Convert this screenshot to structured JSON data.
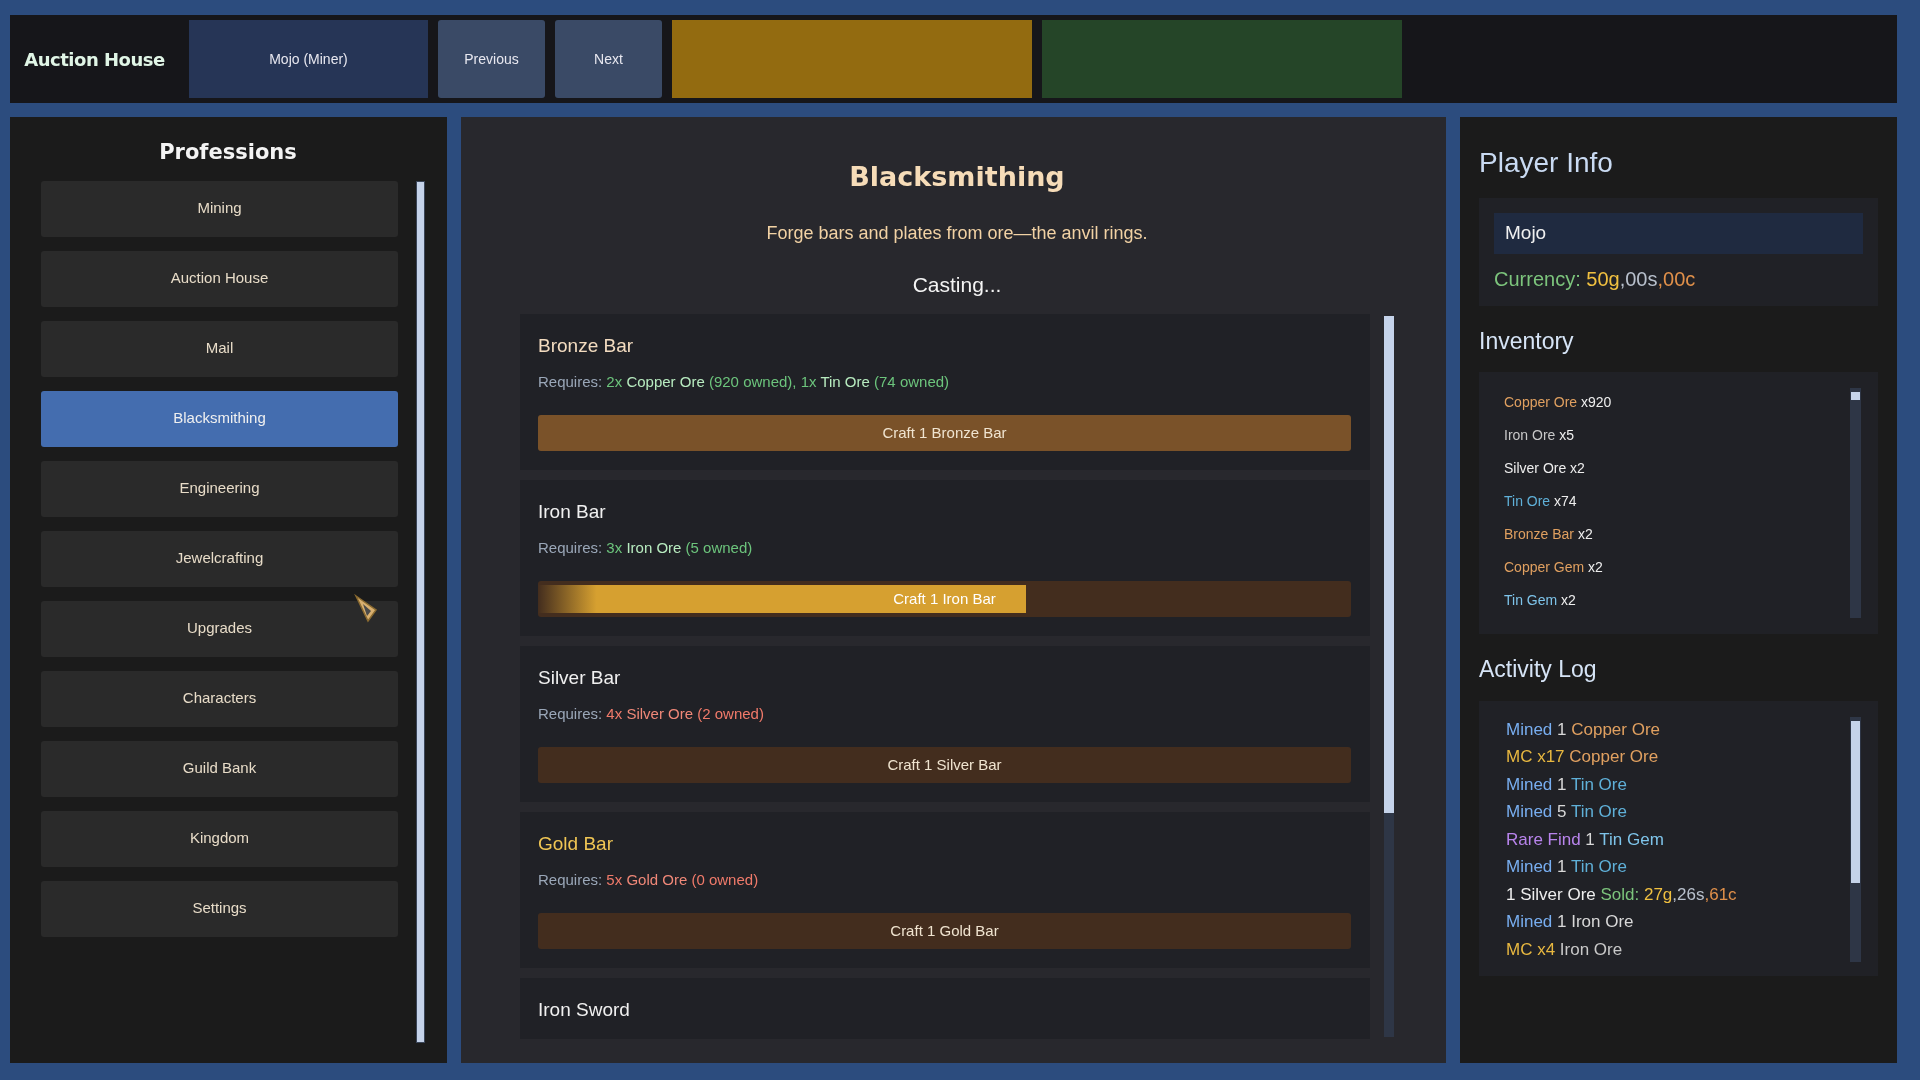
{
  "header": {
    "logo": "Auction House",
    "buttons": [
      {
        "label": "Mojo (Miner)",
        "kind": "character"
      },
      {
        "label": "Previous",
        "kind": "nav"
      },
      {
        "label": "Next",
        "kind": "nav"
      }
    ],
    "blocks": [
      {
        "color": "#936b10"
      },
      {
        "color": "#254528"
      }
    ]
  },
  "sidebar": {
    "title": "Professions",
    "items": [
      {
        "label": "Mining",
        "selected": false
      },
      {
        "label": "Auction House",
        "selected": false
      },
      {
        "label": "Mail",
        "selected": false
      },
      {
        "label": "Blacksmithing",
        "selected": true
      },
      {
        "label": "Engineering",
        "selected": false
      },
      {
        "label": "Jewelcrafting",
        "selected": false
      },
      {
        "label": "Upgrades",
        "selected": false
      },
      {
        "label": "Characters",
        "selected": false
      },
      {
        "label": "Guild Bank",
        "selected": false
      },
      {
        "label": "Kingdom",
        "selected": false
      },
      {
        "label": "Settings",
        "selected": false
      }
    ]
  },
  "profession": {
    "title": "Blacksmithing",
    "description": "Forge bars and plates from ore—the anvil rings.",
    "status": "Casting..."
  },
  "recipes": [
    {
      "name": "Bronze Bar",
      "color": "#f3dcc0",
      "requires_label": "Requires:",
      "requirements": [
        {
          "qty": "2x",
          "item": "Copper Ore",
          "owned": "(920 owned),",
          "met": true
        },
        {
          "qty": "1x",
          "item": "Tin Ore",
          "owned": "(74 owned)",
          "met": true
        }
      ],
      "button": "Craft 1 Bronze Bar",
      "available": true
    },
    {
      "name": "Iron Bar",
      "color": "#f0f0f0",
      "requires_label": "Requires:",
      "requirements": [
        {
          "qty": "3x",
          "item": "Iron Ore",
          "owned": "(5 owned)",
          "met": true
        }
      ],
      "button": "Craft 1 Iron Bar",
      "level": 0.6
    },
    {
      "name": "Silver Bar",
      "color": "#f0f0f0",
      "requires_label": "Requires:",
      "requirements": [
        {
          "qty": "4x",
          "item": "Silver Ore",
          "owned": "(2 owned)",
          "met": false
        }
      ],
      "button": "Craft 1 Silver Bar",
      "available": false
    },
    {
      "name": "Gold Bar",
      "color": "#f0c654",
      "requires_label": "Requires:",
      "requirements": [
        {
          "qty": "5x",
          "item": "Gold Ore",
          "owned": "(0 owned)",
          "met": false
        }
      ],
      "button": "Craft 1 Gold Bar",
      "available": false
    },
    {
      "name": "Iron Sword",
      "color": "#f0f0f0"
    }
  ],
  "player": {
    "title": "Player Info",
    "name": "Mojo",
    "currency": [
      {
        "text": "Currency:",
        "color": "#7cc47c"
      },
      {
        "text": " 50g",
        "color": "#f0c040"
      },
      {
        "text": ",00s",
        "color": "#b8c0cc"
      },
      {
        "text": ",00c",
        "color": "#e0904a"
      }
    ]
  },
  "inventory": {
    "title": "Inventory",
    "items": [
      {
        "name": "Copper Ore",
        "count": "x920",
        "color": "#e0a060"
      },
      {
        "name": "Iron Ore",
        "count": "x5",
        "color": "#c8c8c8"
      },
      {
        "name": "Silver Ore",
        "count": "x2",
        "color": "#eeeeee"
      },
      {
        "name": "Tin Ore",
        "count": "x74",
        "color": "#5fb0d8"
      },
      {
        "name": "Bronze Bar",
        "count": "x2",
        "color": "#e0a060"
      },
      {
        "name": "Copper Gem",
        "count": "x2",
        "color": "#e0a060"
      },
      {
        "name": "Tin Gem",
        "count": "x2",
        "color": "#7ec4ea"
      }
    ]
  },
  "activity_log": {
    "title": "Activity Log",
    "entries": [
      [
        {
          "text": "Mined",
          "color": "#78aef0"
        },
        {
          "text": " 1",
          "color": "#d8d8d8"
        },
        {
          "text": " Copper Ore",
          "color": "#e0a060"
        }
      ],
      [
        {
          "text": "MC x17",
          "color": "#e8b840"
        },
        {
          "text": " Copper Ore",
          "color": "#e0a060"
        }
      ],
      [
        {
          "text": "Mined",
          "color": "#78aef0"
        },
        {
          "text": " 1",
          "color": "#d8d8d8"
        },
        {
          "text": " Tin Ore",
          "color": "#5fb0d8"
        }
      ],
      [
        {
          "text": "Mined",
          "color": "#78aef0"
        },
        {
          "text": " 5",
          "color": "#d8d8d8"
        },
        {
          "text": " Tin Ore",
          "color": "#5fb0d8"
        }
      ],
      [
        {
          "text": "Rare Find",
          "color": "#b884ec"
        },
        {
          "text": " 1",
          "color": "#d8d8d8"
        },
        {
          "text": " Tin Gem",
          "color": "#7ec4ea"
        }
      ],
      [
        {
          "text": "Mined",
          "color": "#78aef0"
        },
        {
          "text": " 1",
          "color": "#d8d8d8"
        },
        {
          "text": " Tin Ore",
          "color": "#5fb0d8"
        }
      ],
      [
        {
          "text": "1 Silver Ore",
          "color": "#eeeeee"
        },
        {
          "text": " Sold:",
          "color": "#7cc47c"
        },
        {
          "text": " 27g",
          "color": "#f0c040"
        },
        {
          "text": ",26s",
          "color": "#b8c0cc"
        },
        {
          "text": ",61c",
          "color": "#e0904a"
        }
      ],
      [
        {
          "text": "Mined",
          "color": "#78aef0"
        },
        {
          "text": " 1 Iron Ore",
          "color": "#d8d8d8"
        }
      ],
      [
        {
          "text": "MC x4",
          "color": "#e8b840"
        },
        {
          "text": " Iron Ore",
          "color": "#c8c8c8"
        }
      ]
    ]
  }
}
